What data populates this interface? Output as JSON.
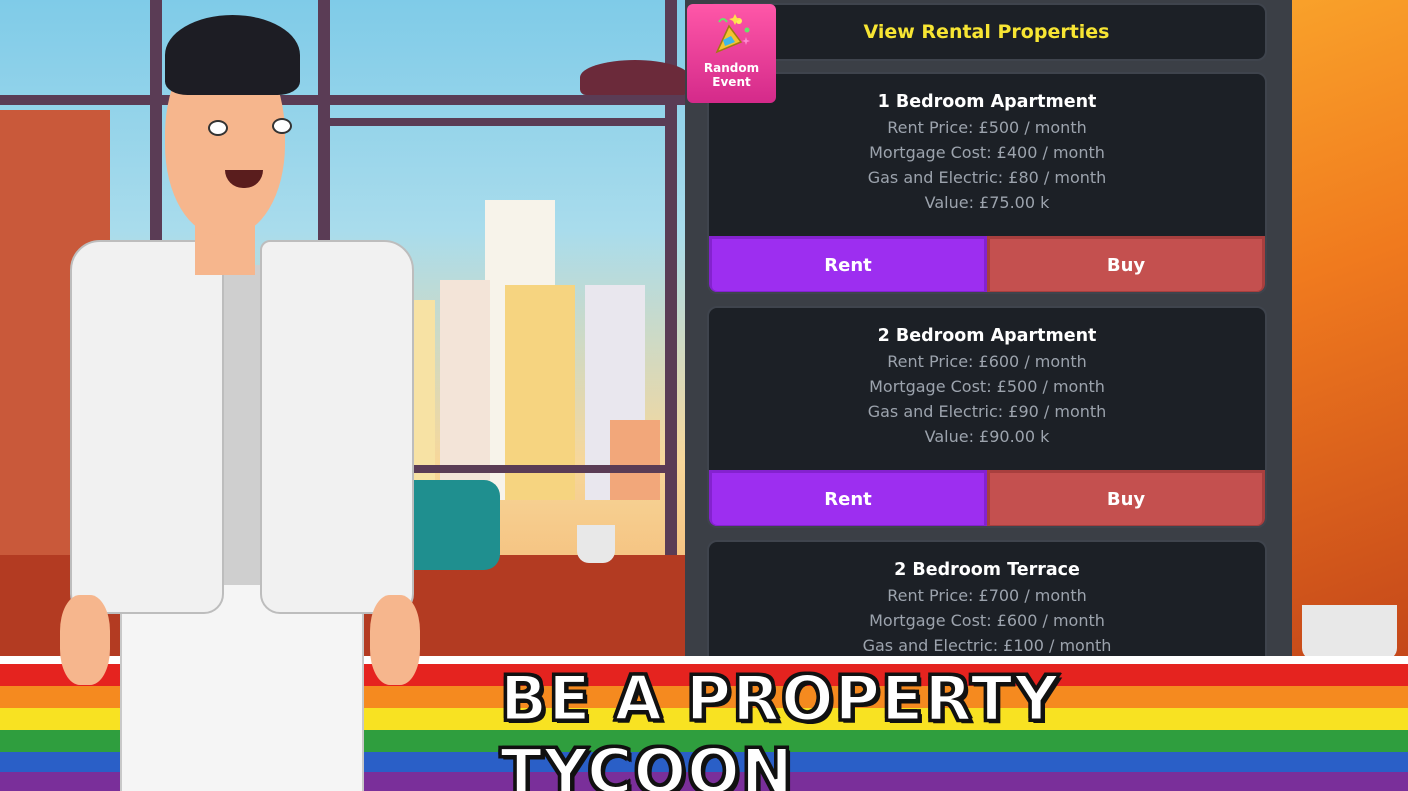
{
  "header": {
    "title": "View Rental Properties"
  },
  "random_event": {
    "label_line1": "Random",
    "label_line2": "Event",
    "icon": "party-popper-icon"
  },
  "properties": [
    {
      "name": "1 Bedroom Apartment",
      "rent": "Rent Price: £500 / month",
      "mortgage": "Mortgage Cost: £400 / month",
      "utilities": "Gas and Electric: £80 / month",
      "value": "Value: £75.00 k",
      "rent_label": "Rent",
      "buy_label": "Buy"
    },
    {
      "name": "2 Bedroom Apartment",
      "rent": "Rent Price: £600 / month",
      "mortgage": "Mortgage Cost: £500 / month",
      "utilities": "Gas and Electric: £90 / month",
      "value": "Value: £90.00 k",
      "rent_label": "Rent",
      "buy_label": "Buy"
    },
    {
      "name": "2 Bedroom Terrace",
      "rent": "Rent Price: £700 / month",
      "mortgage": "Mortgage Cost: £600 / month",
      "utilities": "Gas and Electric: £100 / month"
    }
  ],
  "banner": {
    "text": "BE A PROPERTY TYCOON"
  },
  "colors": {
    "header_text": "#f7e533",
    "rent_button": "#9d2ef0",
    "buy_button": "#c4504f",
    "card_bg": "#1c2026",
    "panel_bg": "#3b3f46",
    "random_event": "#ff57a8"
  }
}
